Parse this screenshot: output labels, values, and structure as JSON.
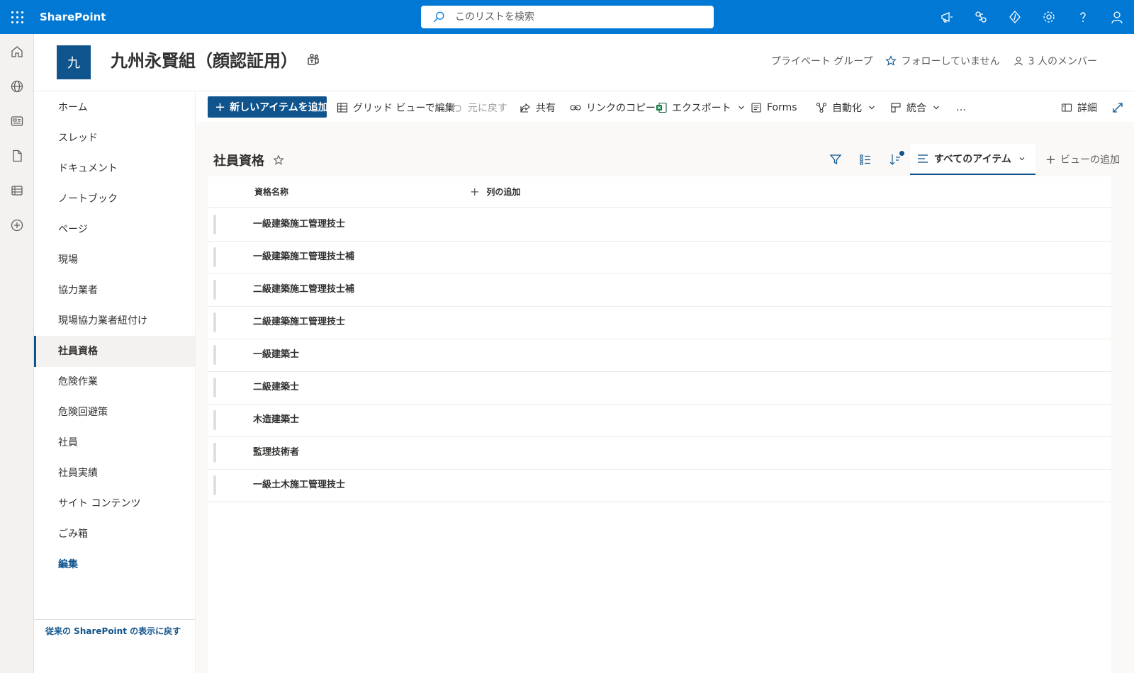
{
  "suite": {
    "brand": "SharePoint",
    "search_placeholder": "このリストを検索",
    "icons": [
      "megaphone-icon",
      "skype-icon",
      "code-icon",
      "gear-icon",
      "help-icon",
      "person-icon"
    ]
  },
  "appbar": {
    "icons": [
      "home-icon",
      "globe-icon",
      "news-icon",
      "file-icon",
      "list-icon",
      "add-circle-icon"
    ]
  },
  "site": {
    "logo_letter": "九",
    "title": "九州永賢組（顔認証用）",
    "privacy": "プライベート グループ",
    "follow": "フォローしていません",
    "members": "3 人のメンバー"
  },
  "nav": {
    "items": [
      {
        "label": "ホーム"
      },
      {
        "label": "スレッド"
      },
      {
        "label": "ドキュメント"
      },
      {
        "label": "ノートブック"
      },
      {
        "label": "ページ"
      },
      {
        "label": "現場"
      },
      {
        "label": "協力業者"
      },
      {
        "label": "現場協力業者紐付け"
      },
      {
        "label": "社員資格"
      },
      {
        "label": "危険作業"
      },
      {
        "label": "危険回避策"
      },
      {
        "label": "社員"
      },
      {
        "label": "社員実績"
      },
      {
        "label": "サイト コンテンツ"
      },
      {
        "label": "ごみ箱"
      },
      {
        "label": "編集"
      }
    ],
    "active_index": 8,
    "classic_link": "従来の SharePoint の表示に戻す"
  },
  "commands": {
    "new_item": "新しいアイテムを追加",
    "grid_edit": "グリッド ビューで編集",
    "undo": "元に戻す",
    "share": "共有",
    "copy_link": "リンクのコピー",
    "export": "エクスポート",
    "forms": "Forms",
    "automate": "自動化",
    "integrate": "統合",
    "more": "…",
    "details": "詳細"
  },
  "list": {
    "title": "社員資格",
    "view_name": "すべてのアイテム",
    "add_view": "ビューの追加",
    "column_header": "資格名称",
    "add_column": "列の追加",
    "rows": [
      "一級建築施工管理技士",
      "一級建築施工管理技士補",
      "二級建築施工管理技士補",
      "二級建築施工管理技士",
      "一級建築士",
      "二級建築士",
      "木造建築士",
      "監理技術者",
      "一級土木施工管理技士"
    ]
  },
  "colors": {
    "suite_blue": "#0078d4",
    "theme_dark": "#0f548c"
  }
}
